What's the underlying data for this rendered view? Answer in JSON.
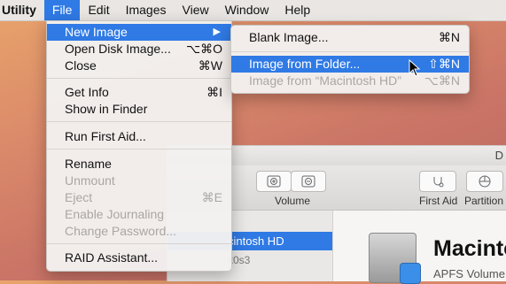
{
  "menubar": {
    "items": [
      "Utility",
      "File",
      "Edit",
      "Images",
      "View",
      "Window",
      "Help"
    ],
    "active": "File"
  },
  "file_menu": {
    "items": [
      {
        "label": "New Image",
        "shortcut": "",
        "selected": true,
        "submenu": true
      },
      {
        "label": "Open Disk Image...",
        "shortcut": "⌥⌘O"
      },
      {
        "label": "Close",
        "shortcut": "⌘W"
      },
      {
        "label": "Get Info",
        "shortcut": "⌘I"
      },
      {
        "label": "Show in Finder",
        "shortcut": ""
      },
      {
        "label": "Run First Aid...",
        "shortcut": ""
      },
      {
        "label": "Rename",
        "shortcut": ""
      },
      {
        "label": "Unmount",
        "shortcut": "",
        "disabled": true
      },
      {
        "label": "Eject",
        "shortcut": "⌘E",
        "disabled": true
      },
      {
        "label": "Enable Journaling",
        "shortcut": "",
        "disabled": true
      },
      {
        "label": "Change Password...",
        "shortcut": "",
        "disabled": true
      },
      {
        "label": "RAID Assistant...",
        "shortcut": ""
      }
    ]
  },
  "new_image_submenu": {
    "items": [
      {
        "label": "Blank Image...",
        "shortcut": "⌘N"
      },
      {
        "label": "Image from Folder...",
        "shortcut": "⇧⌘N",
        "selected": true
      },
      {
        "label": "Image from “Macintosh HD”",
        "shortcut": "⌥⌘N",
        "disabled": true
      }
    ]
  },
  "window": {
    "title": "D",
    "toolbar": {
      "volume_label": "Volume",
      "first_aid_label": "First Aid",
      "partition_label": "Partition"
    },
    "sidebar": {
      "selected_item": "cintosh HD",
      "sub_item": "k0s3"
    },
    "disk": {
      "name": "Macinto",
      "description": "APFS Volume"
    }
  },
  "colors": {
    "selection": "#2f7ae5",
    "menu_bg": "#f3f1f0",
    "disabled_text": "#a9a6a3"
  }
}
